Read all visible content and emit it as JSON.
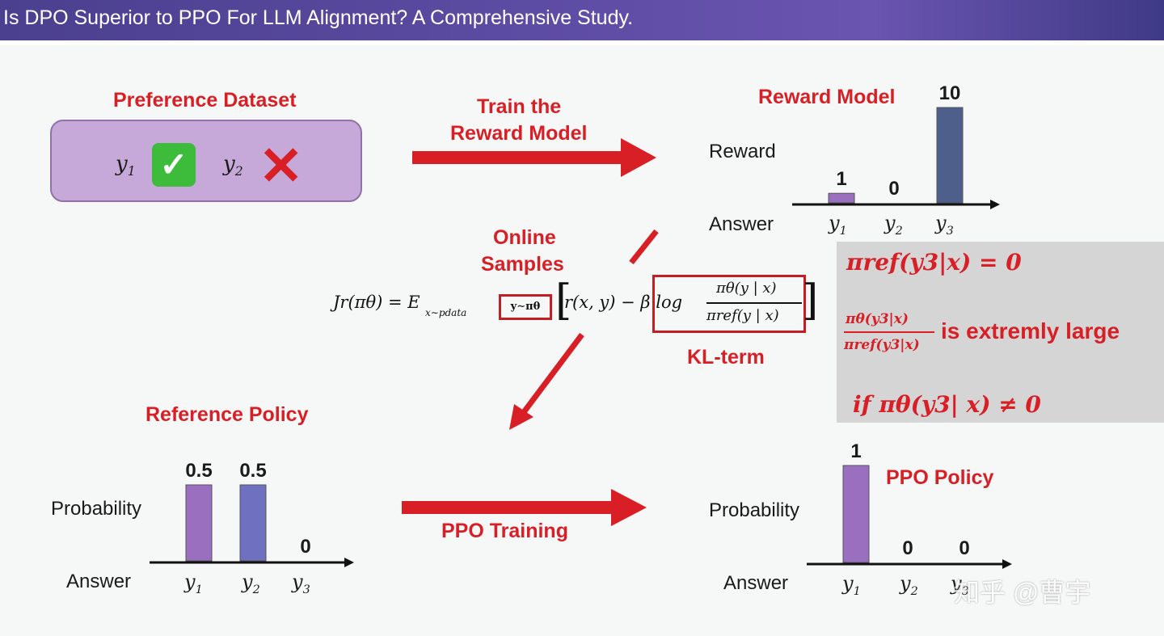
{
  "title": "Is DPO Superior to PPO For LLM Alignment? A Comprehensive Study.",
  "preference_dataset": {
    "heading": "Preference Dataset",
    "y1": "y1",
    "y2": "y2"
  },
  "train_arrow": {
    "line1": "Train the",
    "line2": "Reward Model"
  },
  "reward_model": {
    "heading": "Reward Model",
    "ylabel": "Reward",
    "xlabel": "Answer",
    "categories": [
      "y1",
      "y2",
      "y3"
    ],
    "values": [
      1,
      0,
      10
    ],
    "value_labels": [
      "1",
      "0",
      "10"
    ],
    "bar_colors": [
      "#9b6fbf",
      "#6c6cbf",
      "#4d5f8a"
    ]
  },
  "online_samples": {
    "line1": "Online",
    "line2": "Samples"
  },
  "formula": {
    "lhs": "Jr(πθ) = E",
    "sub_left": "x∼pdata",
    "sub_box": "y∼πθ",
    "body": "r(x, y) − β log",
    "numerator": "πθ(y | x)",
    "denominator": "πref(y | x)"
  },
  "kl_label": "KL-term",
  "gray_panel": {
    "line1": "πref(y3|x) = 0",
    "frac_num": "πθ(y3|x)",
    "frac_den": "πref(y3|x)",
    "line2_text": "is extremly large",
    "line3": "if πθ(y3| x) ≠ 0"
  },
  "reference_policy": {
    "heading": "Reference Policy",
    "ylabel": "Probability",
    "xlabel": "Answer",
    "categories": [
      "y1",
      "y2",
      "y3"
    ],
    "values": [
      0.5,
      0.5,
      0
    ],
    "value_labels": [
      "0.5",
      "0.5",
      "0"
    ],
    "bar_colors": [
      "#9b6fbf",
      "#7070c0",
      "#7070c0"
    ]
  },
  "ppo_training": "PPO Training",
  "ppo_policy": {
    "heading": "PPO Policy",
    "ylabel": "Probability",
    "xlabel": "Answer",
    "categories": [
      "y1",
      "y2",
      "y3"
    ],
    "values": [
      1,
      0,
      0
    ],
    "value_labels": [
      "1",
      "0",
      "0"
    ],
    "bar_colors": [
      "#9b6fbf",
      "#9b6fbf",
      "#9b6fbf"
    ]
  },
  "watermark": "知乎 @曹宇",
  "colors": {
    "accent_red": "#d81f26",
    "title_bar": "#5a4aa0",
    "panel_gray": "#d5d5d5"
  }
}
